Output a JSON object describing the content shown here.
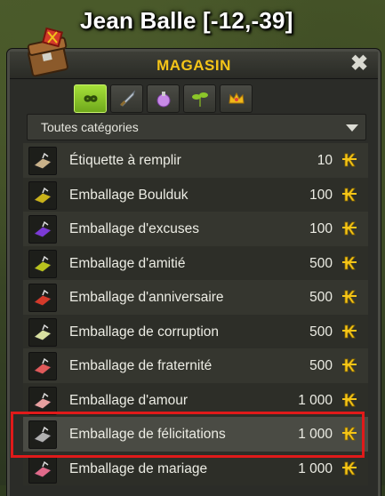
{
  "location": "Jean Balle [-12,-39]",
  "window": {
    "title": "MAGASIN",
    "close_symbol": "✖"
  },
  "tabs": [
    {
      "icon": "infinity-icon",
      "active": true
    },
    {
      "icon": "sword-icon",
      "active": false
    },
    {
      "icon": "potion-icon",
      "active": false
    },
    {
      "icon": "plant-icon",
      "active": false
    },
    {
      "icon": "crown-icon",
      "active": false
    }
  ],
  "filter": {
    "selected": "Toutes catégories"
  },
  "currency_icon": "kama-icon",
  "items": [
    {
      "name": "Étiquette à remplir",
      "price": "10",
      "icon_color": "#c9b28a"
    },
    {
      "name": "Emballage Boulduk",
      "price": "100",
      "icon_color": "#c9b21a"
    },
    {
      "name": "Emballage d'excuses",
      "price": "100",
      "icon_color": "#7b3ad6"
    },
    {
      "name": "Emballage d'amitié",
      "price": "500",
      "icon_color": "#b8c21e"
    },
    {
      "name": "Emballage d'anniversaire",
      "price": "500",
      "icon_color": "#d43a2a"
    },
    {
      "name": "Emballage de corruption",
      "price": "500",
      "icon_color": "#d8e0a0"
    },
    {
      "name": "Emballage de fraternité",
      "price": "500",
      "icon_color": "#e05a5a"
    },
    {
      "name": "Emballage d'amour",
      "price": "1 000",
      "icon_color": "#e8a0a0"
    },
    {
      "name": "Emballage de félicitations",
      "price": "1 000",
      "icon_color": "#b0b0b0"
    },
    {
      "name": "Emballage de mariage",
      "price": "1 000",
      "icon_color": "#e06a8a"
    }
  ],
  "selected_index": 8,
  "colors": {
    "accent": "#f5c518",
    "highlight": "#e01a1a",
    "tab_active": "#8cc629"
  }
}
